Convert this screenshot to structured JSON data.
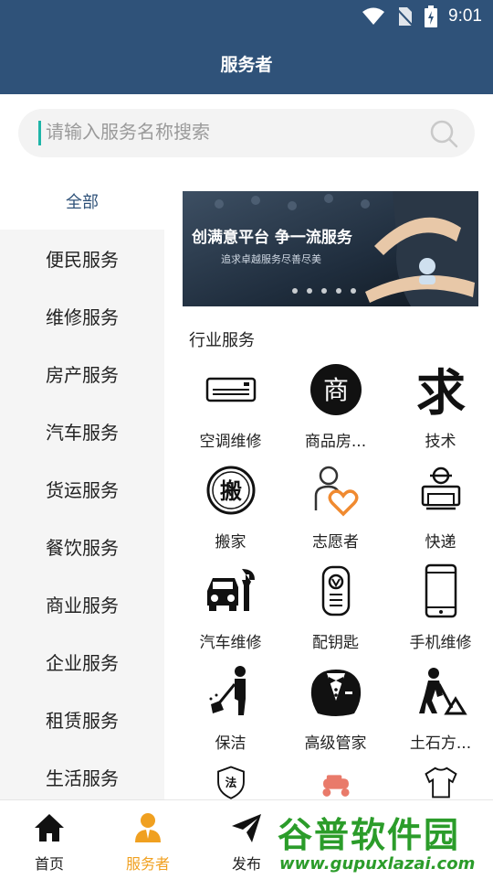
{
  "status": {
    "time": "9:01"
  },
  "header": {
    "title": "服务者"
  },
  "search": {
    "placeholder": "请输入服务名称搜索"
  },
  "sidebar": {
    "items": [
      {
        "label": "全部",
        "active": true
      },
      {
        "label": "便民服务"
      },
      {
        "label": "维修服务"
      },
      {
        "label": "房产服务"
      },
      {
        "label": "汽车服务"
      },
      {
        "label": "货运服务"
      },
      {
        "label": "餐饮服务"
      },
      {
        "label": "商业服务"
      },
      {
        "label": "企业服务"
      },
      {
        "label": "租赁服务"
      },
      {
        "label": "生活服务"
      }
    ]
  },
  "banner": {
    "title": "创满意平台 争一流服务",
    "subtitle": "追求卓越服务尽善尽美",
    "dot_count": 5
  },
  "section": {
    "title": "行业服务"
  },
  "services": [
    {
      "label": "空调维修",
      "icon": "air-conditioner-icon"
    },
    {
      "label": "商品房...",
      "icon": "shang-badge-icon"
    },
    {
      "label": "技术",
      "icon": "qiu-character-icon"
    },
    {
      "label": "搬家",
      "icon": "ban-stamp-icon"
    },
    {
      "label": "志愿者",
      "icon": "volunteer-heart-icon"
    },
    {
      "label": "快递",
      "icon": "courier-icon"
    },
    {
      "label": "汽车维修",
      "icon": "car-wrench-icon"
    },
    {
      "label": "配钥匙",
      "icon": "car-key-icon"
    },
    {
      "label": "手机维修",
      "icon": "mobile-phone-icon"
    },
    {
      "label": "保洁",
      "icon": "cleaner-icon"
    },
    {
      "label": "高级管家",
      "icon": "butler-tuxedo-icon"
    },
    {
      "label": "土石方...",
      "icon": "digging-worker-icon"
    },
    {
      "label": "",
      "icon": "law-shield-icon"
    },
    {
      "label": "",
      "icon": "scooter-icon"
    },
    {
      "label": "",
      "icon": "tshirt-icon"
    }
  ],
  "tabbar": {
    "tabs": [
      {
        "label": "首页",
        "icon": "home-icon"
      },
      {
        "label": "服务者",
        "icon": "user-icon",
        "active": true
      },
      {
        "label": "发布",
        "icon": "paper-plane-icon"
      }
    ]
  },
  "watermark": {
    "text": "谷普软件园",
    "url": "www.gupuxlazai.com"
  },
  "colors": {
    "primary": "#2f5279",
    "accent": "#f0a020",
    "caret": "#1fb5a8",
    "watermark": "#2b9c2a"
  }
}
